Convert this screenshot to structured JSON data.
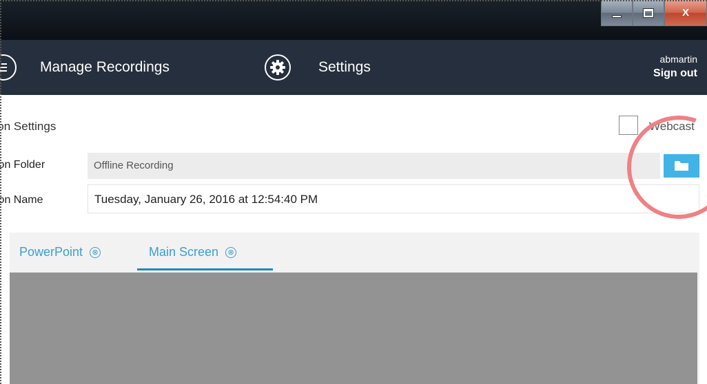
{
  "window": {
    "close_label": "X"
  },
  "header": {
    "manage_label": "Manage Recordings",
    "settings_label": "Settings",
    "username": "abmartin",
    "sign_out_label": "Sign out"
  },
  "session": {
    "title": "sion Settings",
    "webcast_label": "Webcast",
    "webcast_checked": false,
    "folder_label": "sion Folder",
    "folder_value": "Offline Recording",
    "name_label": "sion Name",
    "name_value": "Tuesday, January 26, 2016 at 12:54:40 PM"
  },
  "tabs": [
    {
      "label": "PowerPoint",
      "close_glyph": "⊗"
    },
    {
      "label": "Main Screen",
      "close_glyph": "⊗",
      "active": true
    }
  ],
  "colors": {
    "accent": "#42b3e6",
    "tab_text": "#3a9fd4",
    "header_bg": "#262f3d",
    "highlight": "#ef8184"
  },
  "icons": {
    "menu": "menu-icon",
    "settings": "gear-icon",
    "folder": "folder-icon",
    "minimize": "minimize-icon",
    "maximize": "maximize-icon",
    "close": "close-icon"
  }
}
